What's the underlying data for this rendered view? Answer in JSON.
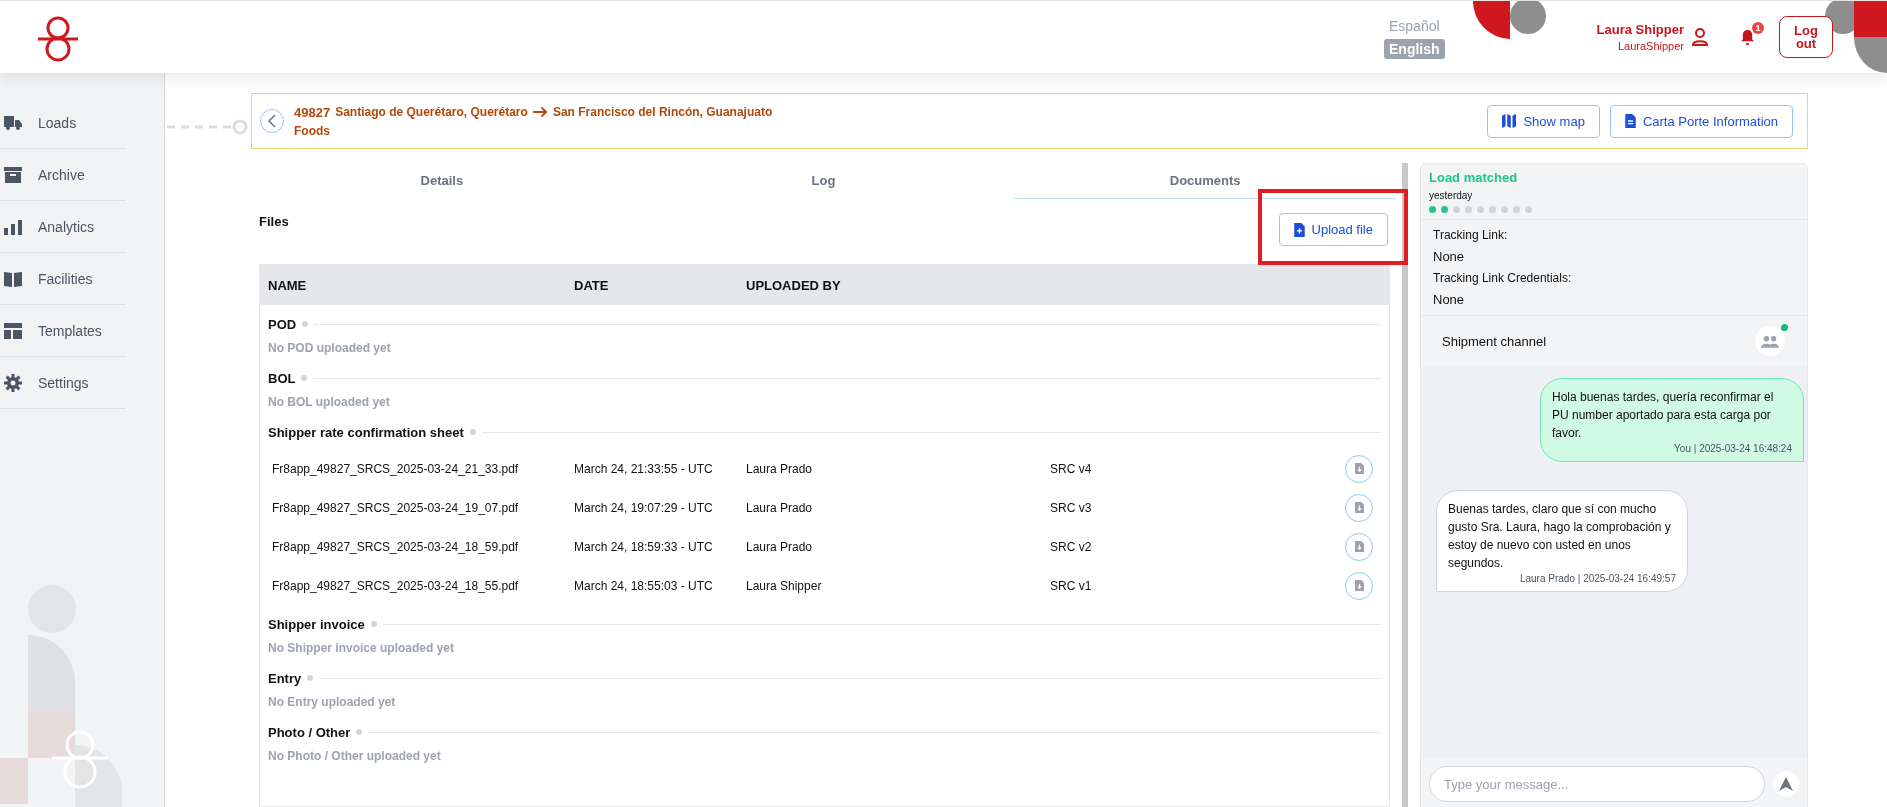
{
  "header": {
    "languages": [
      {
        "label": "Español",
        "selected": false
      },
      {
        "label": "English",
        "selected": true
      }
    ],
    "user": {
      "name": "Laura Shipper",
      "username": "LauraShipper"
    },
    "notifications": {
      "count": "1"
    },
    "logout": "Log out"
  },
  "sidebar": {
    "items": [
      {
        "label": "Loads",
        "kind": "loads"
      },
      {
        "label": "Archive",
        "kind": "archive"
      },
      {
        "label": "Analytics",
        "kind": "analytics"
      },
      {
        "label": "Facilities",
        "kind": "facilities"
      },
      {
        "label": "Templates",
        "kind": "templates"
      },
      {
        "label": "Settings",
        "kind": "settings"
      }
    ]
  },
  "load": {
    "id": "49827",
    "origin": "Santiago de Querétaro, Querétaro",
    "destination": "San Francisco del Rincón, Guanajuato",
    "commodity": "Foods",
    "buttons": [
      {
        "label": "Show map",
        "kind": "map"
      },
      {
        "label": "Carta Porte Information",
        "kind": "document"
      }
    ]
  },
  "tabs": [
    {
      "label": "Details",
      "selected": false
    },
    {
      "label": "Log",
      "selected": false
    },
    {
      "label": "Documents",
      "selected": true
    }
  ],
  "files": {
    "title": "Files",
    "upload_button": "Upload file",
    "columns": [
      "NAME",
      "DATE",
      "UPLOADED BY"
    ],
    "sections": [
      {
        "title": "POD",
        "empty_text": "No POD uploaded yet"
      },
      {
        "title": "BOL",
        "empty_text": "No BOL uploaded yet"
      },
      {
        "title": "Shipper rate confirmation sheet",
        "files": [
          {
            "name": "Fr8app_49827_SRCS_2025-03-24_21_33.pdf",
            "date": "March 24, 21:33:55 - UTC",
            "uploaded_by": "Laura Prado",
            "column_4": "SRC v4"
          },
          {
            "name": "Fr8app_49827_SRCS_2025-03-24_19_07.pdf",
            "date": "March 24, 19:07:29 - UTC",
            "uploaded_by": "Laura Prado",
            "column_4": "SRC v3"
          },
          {
            "name": "Fr8app_49827_SRCS_2025-03-24_18_59.pdf",
            "date": "March 24, 18:59:33 - UTC",
            "uploaded_by": "Laura Prado",
            "column_4": "SRC v2"
          },
          {
            "name": "Fr8app_49827_SRCS_2025-03-24_18_55.pdf",
            "date": "March 24, 18:55:03 - UTC",
            "uploaded_by": "Laura Shipper",
            "column_4": "SRC v1"
          }
        ]
      },
      {
        "title": "Shipper invoice",
        "empty_text": "No Shipper invoice uploaded yet"
      },
      {
        "title": "Entry",
        "empty_text": "No Entry uploaded yet"
      },
      {
        "title": "Photo / Other",
        "empty_text": "No Photo / Other uploaded yet"
      }
    ]
  },
  "status": {
    "label": "Load matched",
    "time": "yesterday",
    "steps": [
      {
        "done": true
      },
      {
        "done": true
      },
      {
        "done": false
      },
      {
        "done": false
      },
      {
        "done": false
      },
      {
        "done": false
      },
      {
        "done": false
      },
      {
        "done": false
      },
      {
        "done": false
      }
    ]
  },
  "tracking": [
    {
      "label": "Tracking Link:",
      "value": "None"
    },
    {
      "label": "Tracking Link Credentials:",
      "value": "None"
    }
  ],
  "chat": {
    "title": "Shipment channel",
    "online": true,
    "messages": [
      {
        "own": true,
        "text": "Hola buenas tardes, quería reconfirmar el PU number aportado para esta carga por favor.",
        "meta": "You | 2025-03-24 16:48:24"
      },
      {
        "own": false,
        "text": "Buenas tardes, claro que sí con mucho gusto Sra. Laura, hago la comprobación y estoy de nuevo con usted en unos segundos.",
        "meta": "Laura Prado | 2025-03-24 16:49:57"
      }
    ],
    "input": {
      "placeholder": "Type your message..."
    }
  }
}
